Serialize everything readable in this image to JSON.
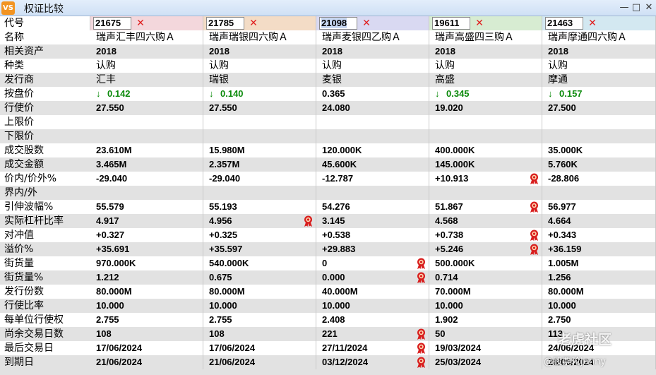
{
  "window": {
    "icon_text": "VS",
    "title": "权证比较",
    "minimize": "—",
    "maximize": "□",
    "close": "✕"
  },
  "header_label": "代号",
  "columns": [
    {
      "code": "21675",
      "bg": "#f3d7dc",
      "selected": false
    },
    {
      "code": "21785",
      "bg": "#f3dcc6",
      "selected": false
    },
    {
      "code": "21098",
      "bg": "#d9d9f2",
      "selected": true
    },
    {
      "code": "19611",
      "bg": "#d7ecd2",
      "selected": false
    },
    {
      "code": "21463",
      "bg": "#d3e8f1",
      "selected": false
    }
  ],
  "rows": [
    {
      "label": "名称",
      "style": "cjk",
      "values": [
        "瑞声汇丰四六购Ａ",
        "瑞声瑞银四六购Ａ",
        "瑞声麦银四乙购Ａ",
        "瑞声高盛四三购Ａ",
        "瑞声摩通四六购Ａ"
      ]
    },
    {
      "label": "相关资产",
      "style": "num",
      "values": [
        "2018",
        "2018",
        "2018",
        "2018",
        "2018"
      ]
    },
    {
      "label": "种类",
      "style": "cjk",
      "values": [
        "认购",
        "认购",
        "认购",
        "认购",
        "认购"
      ]
    },
    {
      "label": "发行商",
      "style": "cjk",
      "values": [
        "汇丰",
        "瑞银",
        "麦银",
        "高盛",
        "摩通"
      ]
    },
    {
      "label": "按盘价",
      "style": "num",
      "values": [
        "0.142",
        "0.140",
        "0.365",
        "0.345",
        "0.157"
      ],
      "arrows": [
        true,
        true,
        false,
        true,
        true
      ],
      "green": [
        true,
        true,
        false,
        true,
        true
      ]
    },
    {
      "label": "行使价",
      "style": "num",
      "values": [
        "27.550",
        "27.550",
        "24.080",
        "19.020",
        "27.500"
      ]
    },
    {
      "label": "上限价",
      "style": "num",
      "values": [
        "",
        "",
        "",
        "",
        ""
      ]
    },
    {
      "label": "下限价",
      "style": "num",
      "values": [
        "",
        "",
        "",
        "",
        ""
      ]
    },
    {
      "label": "成交股数",
      "style": "num",
      "values": [
        "23.610M",
        "15.980M",
        "120.000K",
        "400.000K",
        "35.000K"
      ]
    },
    {
      "label": "成交金额",
      "style": "num",
      "values": [
        "3.465M",
        "2.357M",
        "45.600K",
        "145.000K",
        "5.760K"
      ]
    },
    {
      "label": "价内/价外%",
      "style": "num",
      "values": [
        "-29.040",
        "-29.040",
        "-12.787",
        "+10.913",
        "-28.806"
      ],
      "medals": [
        false,
        false,
        false,
        true,
        false
      ]
    },
    {
      "label": "界内/外",
      "style": "num",
      "values": [
        "",
        "",
        "",
        "",
        ""
      ]
    },
    {
      "label": "引伸波幅%",
      "style": "num",
      "values": [
        "55.579",
        "55.193",
        "54.276",
        "51.867",
        "56.977"
      ],
      "medals": [
        false,
        false,
        false,
        true,
        false
      ]
    },
    {
      "label": "实际杠杆比率",
      "style": "num",
      "values": [
        "4.917",
        "4.956",
        "3.145",
        "4.568",
        "4.664"
      ],
      "medals": [
        false,
        true,
        false,
        false,
        false
      ]
    },
    {
      "label": "对冲值",
      "style": "num",
      "values": [
        "+0.327",
        "+0.325",
        "+0.538",
        "+0.738",
        "+0.343"
      ],
      "medals": [
        false,
        false,
        false,
        true,
        false
      ]
    },
    {
      "label": "溢价%",
      "style": "num",
      "values": [
        "+35.691",
        "+35.597",
        "+29.883",
        "+5.246",
        "+36.159"
      ],
      "medals": [
        false,
        false,
        false,
        true,
        false
      ]
    },
    {
      "label": "街货量",
      "style": "num",
      "values": [
        "970.000K",
        "540.000K",
        "0",
        "500.000K",
        "1.005M"
      ],
      "medals": [
        false,
        false,
        true,
        false,
        false
      ]
    },
    {
      "label": "街货量%",
      "style": "num",
      "values": [
        "1.212",
        "0.675",
        "0.000",
        "0.714",
        "1.256"
      ],
      "medals": [
        false,
        false,
        true,
        false,
        false
      ]
    },
    {
      "label": "发行份数",
      "style": "num",
      "values": [
        "80.000M",
        "80.000M",
        "40.000M",
        "70.000M",
        "80.000M"
      ]
    },
    {
      "label": "行使比率",
      "style": "num",
      "values": [
        "10.000",
        "10.000",
        "10.000",
        "10.000",
        "10.000"
      ]
    },
    {
      "label": "每单位行使权",
      "style": "num",
      "values": [
        "2.755",
        "2.755",
        "2.408",
        "1.902",
        "2.750"
      ]
    },
    {
      "label": "尚余交易日数",
      "style": "num",
      "values": [
        "108",
        "108",
        "221",
        "50",
        "113"
      ],
      "medals": [
        false,
        false,
        true,
        false,
        false
      ]
    },
    {
      "label": "最后交易日",
      "style": "num",
      "values": [
        "17/06/2024",
        "17/06/2024",
        "27/11/2024",
        "19/03/2024",
        "24/06/2024"
      ],
      "medals": [
        false,
        false,
        true,
        false,
        false
      ]
    },
    {
      "label": "到期日",
      "style": "num",
      "values": [
        "21/06/2024",
        "21/06/2024",
        "03/12/2024",
        "25/03/2024",
        "28/06/2024"
      ],
      "medals": [
        false,
        false,
        true,
        false,
        false
      ]
    }
  ],
  "icons": {
    "remove": "close-x-icon",
    "down_arrow": "down-arrow-icon",
    "medal": "medal-icon"
  },
  "watermark": {
    "line1": "老虎社区",
    "line2": "@股票轮Jenny"
  },
  "colors": {
    "up_green": "#0b8a0b",
    "remove_red": "#e02222",
    "medal_red": "#d81e1e"
  }
}
